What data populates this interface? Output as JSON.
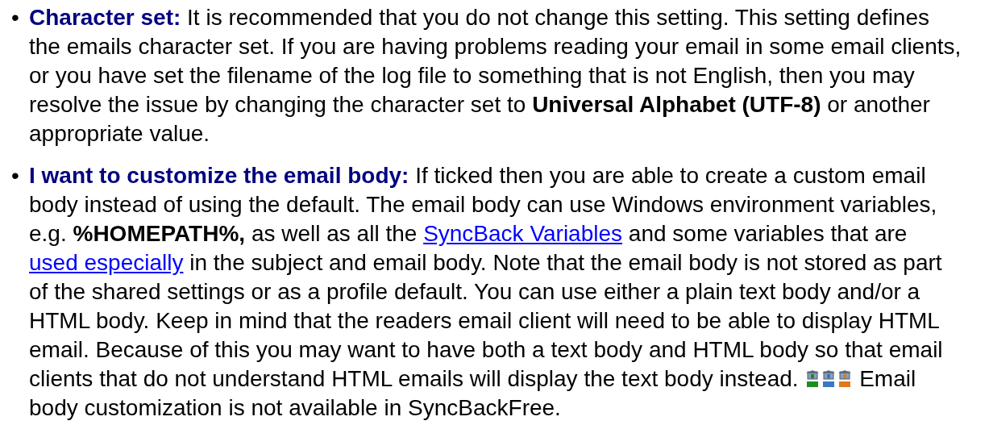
{
  "items": [
    {
      "bullet": "•",
      "term": "Character set:",
      "body": [
        {
          "kind": "text",
          "text": "It is recommended that you do not change this setting. This setting defines the emails character set. If you are having problems reading your email in some email clients, or you have set the filename of the log file to something that is not English, then you may resolve the issue by changing the character set to **Universal Alphabet (UTF-8)** or another appropriate value."
        }
      ]
    },
    {
      "bullet": "•",
      "term": "I want to customize the email body:",
      "body": [
        {
          "kind": "text",
          "text": "If ticked then you are able to create a custom email body instead of using the default. The email body can use Windows environment variables, e.g. **%HOMEPATH%,** as well as all the "
        },
        {
          "kind": "link",
          "text": "SyncBack Variables"
        },
        {
          "kind": "text",
          "text": " and some variables that are "
        },
        {
          "kind": "link",
          "text": "used especially"
        },
        {
          "kind": "text",
          "text": " in the subject and email body. Note that the email body is not stored as part of the shared settings or as a profile default. You can use either a plain text body and/or a HTML body. Keep in mind that the readers email client will need to be able to display HTML email. Because of this you may want to have both a text body and HTML body so that email clients that do not understand HTML emails will display the text body instead. "
        },
        {
          "kind": "edition-icons"
        },
        {
          "kind": "text",
          "text": " Email body customization is not available in SyncBackFree."
        }
      ]
    }
  ]
}
